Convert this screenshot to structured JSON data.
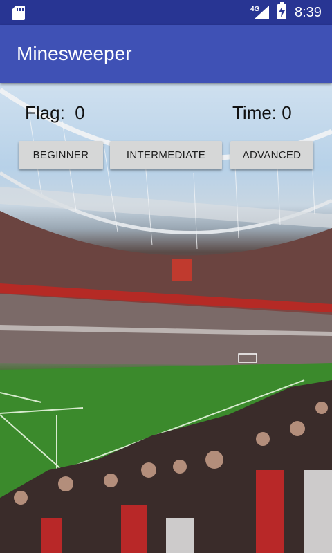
{
  "status_bar": {
    "network_label": "4G",
    "time": "8:39",
    "icons": [
      "sd-card-icon",
      "signal-icon",
      "battery-charging-icon"
    ]
  },
  "app_bar": {
    "title": "Minesweeper"
  },
  "game": {
    "flag_label": "Flag:",
    "flag_count": "0",
    "time_label": "Time:",
    "time_count": "0"
  },
  "difficulty_buttons": {
    "beginner": "BEGINNER",
    "intermediate": "INTERMEDIATE",
    "advanced": "ADVANCED"
  },
  "colors": {
    "status_bar": "#283593",
    "app_bar": "#3f51b5",
    "button": "#d6d7d7"
  }
}
